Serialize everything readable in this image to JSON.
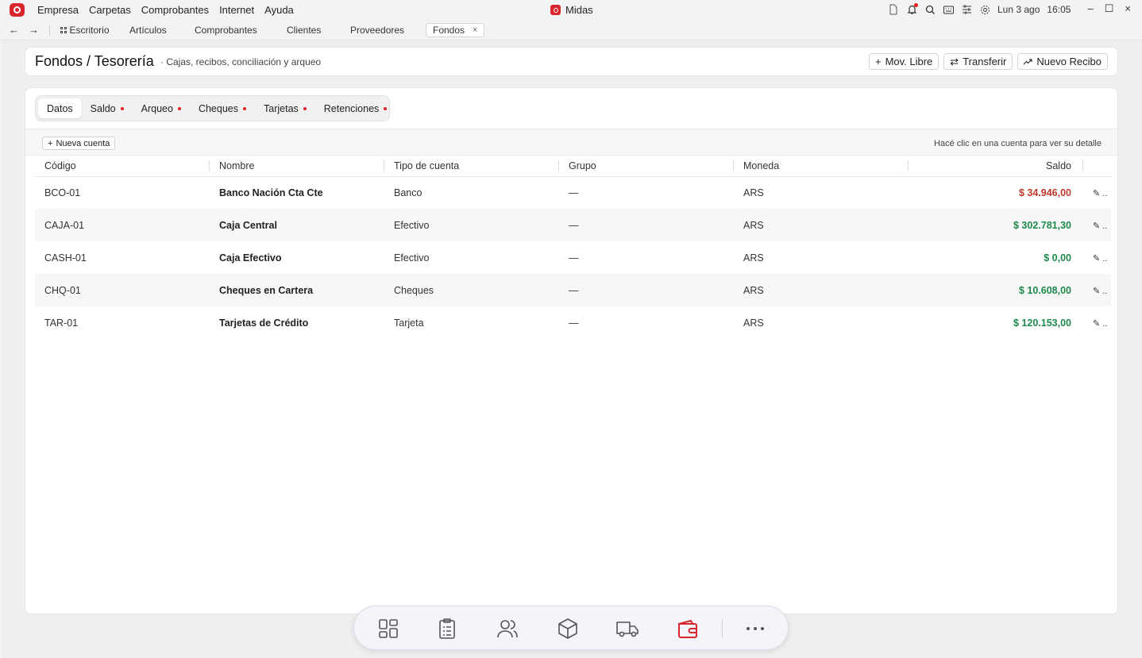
{
  "app": {
    "title": "Midas",
    "menu": [
      "Empresa",
      "Carpetas",
      "Comprobantes",
      "Internet",
      "Ayuda"
    ],
    "date": "Lun 3 ago",
    "time": "16:05",
    "brand_color": "#d8262e"
  },
  "nav": {
    "home_label": "Escritorio",
    "tabs": [
      "Artículos",
      "Comprobantes",
      "Clientes",
      "Proveedores"
    ],
    "active_tab": "Fondos"
  },
  "header": {
    "title": "Fondos / Tesorería",
    "subtitle": "· Cajas, recibos, conciliación y arqueo",
    "buttons": {
      "mov_libre": "Mov. Libre",
      "transferir": "Transferir",
      "nuevo_recibo": "Nuevo Recibo"
    }
  },
  "subtabs": [
    {
      "label": "Datos",
      "active": true,
      "dot": false
    },
    {
      "label": "Saldo",
      "active": false,
      "dot": true
    },
    {
      "label": "Arqueo",
      "active": false,
      "dot": true
    },
    {
      "label": "Cheques",
      "active": false,
      "dot": true
    },
    {
      "label": "Tarjetas",
      "active": false,
      "dot": true
    },
    {
      "label": "Retenciones",
      "active": false,
      "dot": true
    }
  ],
  "toolbar": {
    "new_account": "Nueva cuenta",
    "hint": "Hacé clic en una cuenta para ver su detalle"
  },
  "table": {
    "columns": [
      "Código",
      "Nombre",
      "Tipo de cuenta",
      "Grupo",
      "Moneda",
      "Saldo"
    ],
    "rows": [
      {
        "codigo": "BCO-01",
        "nombre": "Banco Nación Cta Cte",
        "tipo": "Banco",
        "grupo": "—",
        "moneda": "ARS",
        "saldo": "$ 34.946,00",
        "negative": true
      },
      {
        "codigo": "CAJA-01",
        "nombre": "Caja Central",
        "tipo": "Efectivo",
        "grupo": "—",
        "moneda": "ARS",
        "saldo": "$ 302.781,30",
        "negative": false
      },
      {
        "codigo": "CASH-01",
        "nombre": "Caja Efectivo",
        "tipo": "Efectivo",
        "grupo": "—",
        "moneda": "ARS",
        "saldo": "$ 0,00",
        "negative": false
      },
      {
        "codigo": "CHQ-01",
        "nombre": "Cheques en Cartera",
        "tipo": "Cheques",
        "grupo": "—",
        "moneda": "ARS",
        "saldo": "$ 10.608,00",
        "negative": false
      },
      {
        "codigo": "TAR-01",
        "nombre": "Tarjetas de Crédito",
        "tipo": "Tarjeta",
        "grupo": "—",
        "moneda": "ARS",
        "saldo": "$ 120.153,00",
        "negative": false
      }
    ]
  },
  "colors": {
    "negative": "#c0392b",
    "positive": "#1e8a4c",
    "active_dock": "#d8262e"
  },
  "dock": [
    "dashboard-icon",
    "clipboard-icon",
    "users-icon",
    "box-icon",
    "truck-icon",
    "wallet-icon",
    "more-icon"
  ]
}
